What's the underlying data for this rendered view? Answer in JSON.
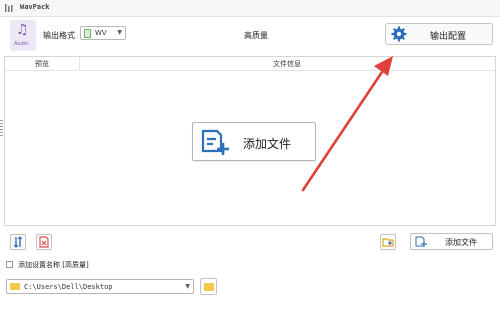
{
  "window": {
    "title": "WavPack",
    "icon": "app-logo-icon"
  },
  "toolbar": {
    "audio_icon_label": "Audio",
    "format_label": "输出格式",
    "format_value": "WV",
    "quality_text": "高质量",
    "output_config_label": "输出配置"
  },
  "table": {
    "col_preview": "预览",
    "col_file_info": "文件信息"
  },
  "center": {
    "add_file_label": "添加文件"
  },
  "bottom": {
    "add_file_label": "添加文件",
    "preset_checkbox_label": "添加设置名称 [高质量]",
    "preset_checked": false,
    "output_path": "C:\\Users\\Dell\\Desktop"
  },
  "colors": {
    "accent_blue": "#2d6fb8",
    "arrow_red": "#e0403a",
    "delete_red": "#d9534f",
    "folder_yellow": "#f2c94c"
  }
}
